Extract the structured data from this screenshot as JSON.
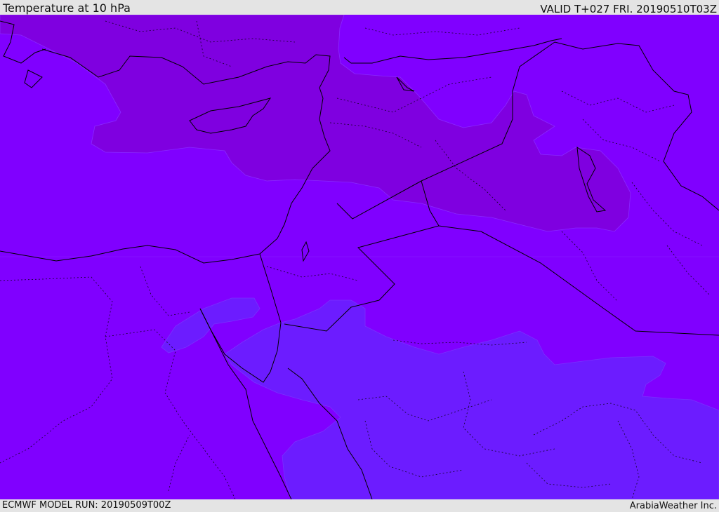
{
  "header": {
    "title": "Temperature at 10 hPa",
    "valid": "VALID T+027 FRI. 20190510T03Z"
  },
  "footer": {
    "model_run": "ECMWF MODEL RUN: 20190509T00Z",
    "credit": "ArabiaWeather Inc."
  },
  "map": {
    "colors": {
      "base": "#8000ff",
      "warm_band": "#7f00e0",
      "cool_band": "#6c1cff",
      "border": "#000000"
    }
  }
}
